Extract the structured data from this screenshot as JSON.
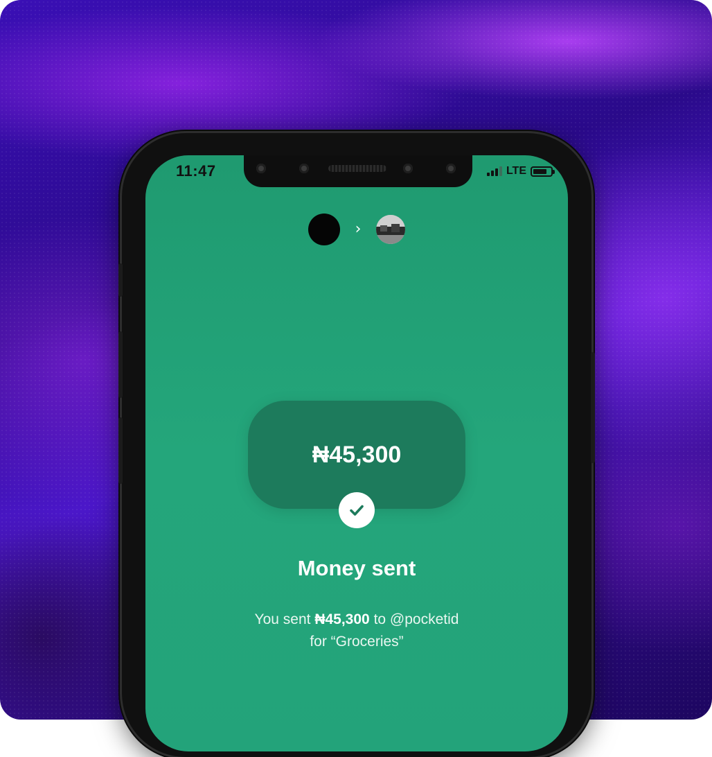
{
  "status_bar": {
    "time": "11:47",
    "network": "LTE",
    "signal_bars": 3,
    "battery_level": 0.8
  },
  "transfer": {
    "sender_avatar": "avatar-dark",
    "arrow_icon": "chevron-right-icon",
    "recipient_avatar": "avatar-photo",
    "amount": "₦45,300",
    "status_icon": "check-icon",
    "title": "Money sent",
    "message_prefix": "You sent",
    "message_amount": "₦45,300",
    "message_to": "to @pocketid",
    "message_line2": "for “Groceries”"
  },
  "colors": {
    "screen_green": "#23a37a",
    "pill_green": "#1d7b5c",
    "background_purple": "#3a0fb5"
  }
}
